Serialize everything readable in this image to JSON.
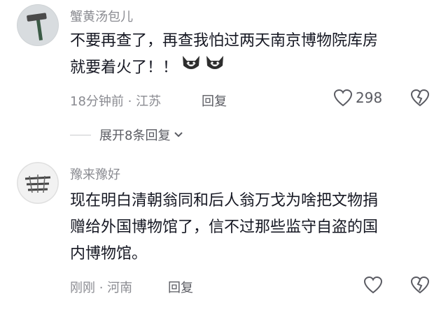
{
  "comments": [
    {
      "username": "蟹黄汤包儿",
      "text_lines": [
        "不要再查了，再查我怕过两天南京博物院库房",
        "就要着火了！！"
      ],
      "emoji_icon": "husky-dog-emoji",
      "time": "18分钟前",
      "location": "江苏",
      "reply_label": "回复",
      "likes": "298",
      "expand_label": "展开8条回复"
    },
    {
      "username": "豫来豫好",
      "text_lines": [
        "现在明白清朝翁同和后人翁万戈为啥把文物捐",
        "赠给外国博物馆了，信不过那些监守自盗的国",
        "内博物馆。"
      ],
      "time": "刚刚",
      "location": "河南",
      "reply_label": "回复"
    }
  ],
  "separator": " · "
}
